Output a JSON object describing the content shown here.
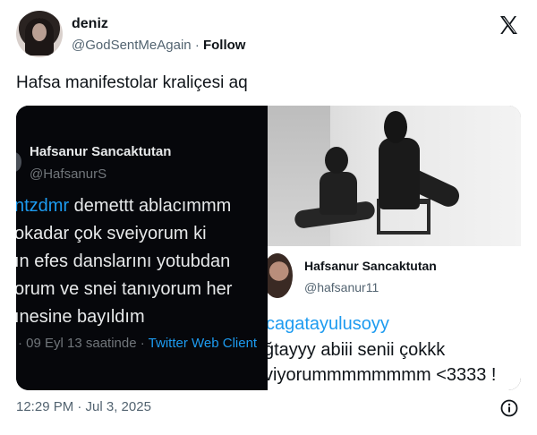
{
  "author": {
    "name": "deniz",
    "handle": "@GodSentMeAgain",
    "separator": "·",
    "follow_label": "Follow"
  },
  "tweet": {
    "text": "Hafsa manifestolar kraliçesi aq"
  },
  "media_left": {
    "name": "Hafsanur Sancaktutan",
    "handle": "@HafsanurS",
    "body_mention": "ntzdmr",
    "body_line1_rest": " demettt ablacımmm",
    "body_line2": "okadar çok sveiyorum ki",
    "body_line3": "ın efes danslarını yotubdan",
    "body_line4": "orum ve snei tanıyorum her",
    "body_line5": "ınesine bayıldım",
    "meta_time": "· 09 Eyl 13 saatinde · ",
    "meta_source": "Twitter Web Client"
  },
  "media_right": {
    "name": "Hafsanur Sancaktutan",
    "handle": "@hafsanur11",
    "mention": "cagatayulusoyy",
    "line1": "ğtayyy abiii senii çokkk",
    "line2": "viyorummmmmmmm <3333 !"
  },
  "footer": {
    "timestamp": "12:29 PM · Jul 3, 2025"
  },
  "icons": {
    "x_logo": "x-logo-icon",
    "info": "info-icon"
  }
}
